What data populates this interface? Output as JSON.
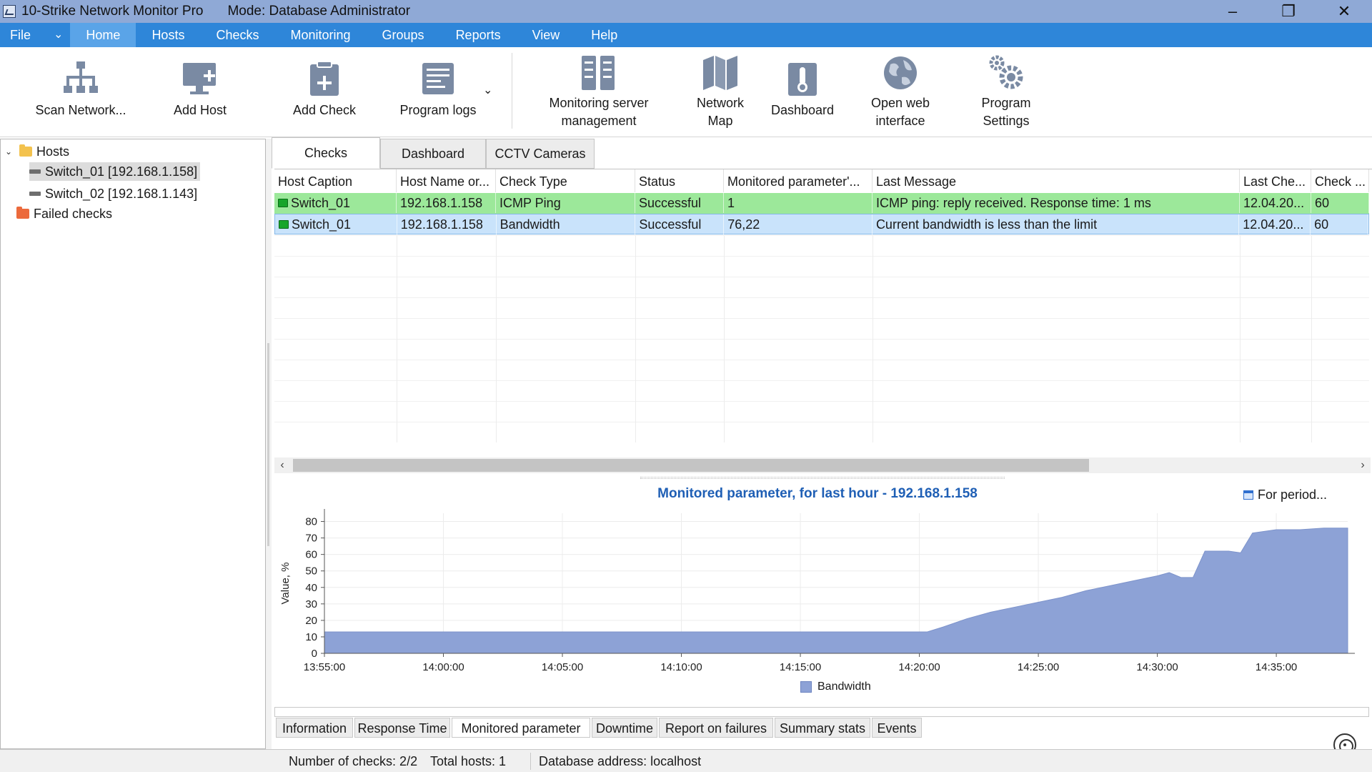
{
  "window": {
    "title": "10-Strike Network Monitor Pro",
    "mode": "Mode: Database Administrator",
    "minimize": "‒",
    "restore": "❐",
    "close": "✕"
  },
  "menu": {
    "file": "File",
    "quick": "⌄",
    "items": [
      "Home",
      "Hosts",
      "Checks",
      "Monitoring",
      "Groups",
      "Reports",
      "View",
      "Help"
    ]
  },
  "ribbon": {
    "scan_network": "Scan Network...",
    "add_host": "Add Host",
    "add_check": "Add Check",
    "program_logs": "Program logs",
    "dropdown": "⌄",
    "monitoring_server_line1": "Monitoring server",
    "monitoring_server_line2": "management",
    "network_map_line1": "Network",
    "network_map_line2": "Map",
    "dashboard": "Dashboard",
    "open_web_line1": "Open web",
    "open_web_line2": "interface",
    "settings_line1": "Program",
    "settings_line2": "Settings"
  },
  "tree": {
    "expander": "⌄",
    "hosts": "Hosts",
    "switch1": "Switch_01 [192.168.1.158]",
    "switch2": "Switch_02 [192.168.1.143]",
    "failed": "Failed checks"
  },
  "tabs": [
    "Checks",
    "Dashboard",
    "CCTV Cameras"
  ],
  "grid": {
    "columns": [
      "Host Caption",
      "Host Name or...",
      "Check Type",
      "Status",
      "Monitored parameter'...",
      "Last Message",
      "Last Che...",
      "Check ..."
    ],
    "rows": [
      [
        "Switch_01",
        "192.168.1.158",
        "ICMP Ping",
        "Successful",
        "1",
        "ICMP ping: reply received. Response time: 1 ms",
        "12.04.20...",
        "60"
      ],
      [
        "Switch_01",
        "192.168.1.158",
        "Bandwidth",
        "Successful",
        "76,22",
        "Current bandwidth is less than the limit",
        "12.04.20...",
        "60"
      ]
    ]
  },
  "scroll": {
    "left": "‹",
    "right": "›"
  },
  "chart_panel": {
    "title": "Monitored parameter, for last hour - 192.168.1.158",
    "period": "For period..."
  },
  "chart_data": {
    "type": "area",
    "title": "Monitored parameter, for last hour - 192.168.1.158",
    "xlabel": "",
    "ylabel": "Value, %",
    "ylim": [
      0,
      85
    ],
    "yticks": [
      0,
      10,
      20,
      30,
      40,
      50,
      60,
      70,
      80
    ],
    "xticks": [
      "13:55:00",
      "14:00:00",
      "14:05:00",
      "14:10:00",
      "14:15:00",
      "14:20:00",
      "14:25:00",
      "14:30:00",
      "14:35:00"
    ],
    "xrange_minutes_from_1355": [
      0,
      43
    ],
    "legend_placement": "bottom",
    "color": "#8da2d6",
    "series": [
      {
        "name": "Bandwidth",
        "x": [
          "13:55:00",
          "14:20:00",
          "14:20:20",
          "14:21:00",
          "14:22:00",
          "14:23:00",
          "14:24:00",
          "14:25:00",
          "14:26:00",
          "14:27:00",
          "14:28:00",
          "14:29:00",
          "14:30:00",
          "14:30:30",
          "14:31:00",
          "14:31:30",
          "14:32:00",
          "14:33:00",
          "14:33:30",
          "14:34:00",
          "14:35:00",
          "14:36:00",
          "14:37:00",
          "14:38:00"
        ],
        "values": [
          13,
          13,
          13,
          16,
          21,
          25,
          28,
          31,
          34,
          38,
          41,
          44,
          47,
          49,
          46,
          46,
          62,
          62,
          61,
          73,
          75,
          75,
          76,
          76
        ]
      }
    ]
  },
  "bottom_tabs": [
    "Information",
    "Response Time",
    "Monitored parameter",
    "Downtime",
    "Report on failures",
    "Summary stats",
    "Events"
  ],
  "status": {
    "checks": "Number of checks: 2/2",
    "hosts": "Total hosts: 1",
    "db": "Database address: localhost"
  }
}
